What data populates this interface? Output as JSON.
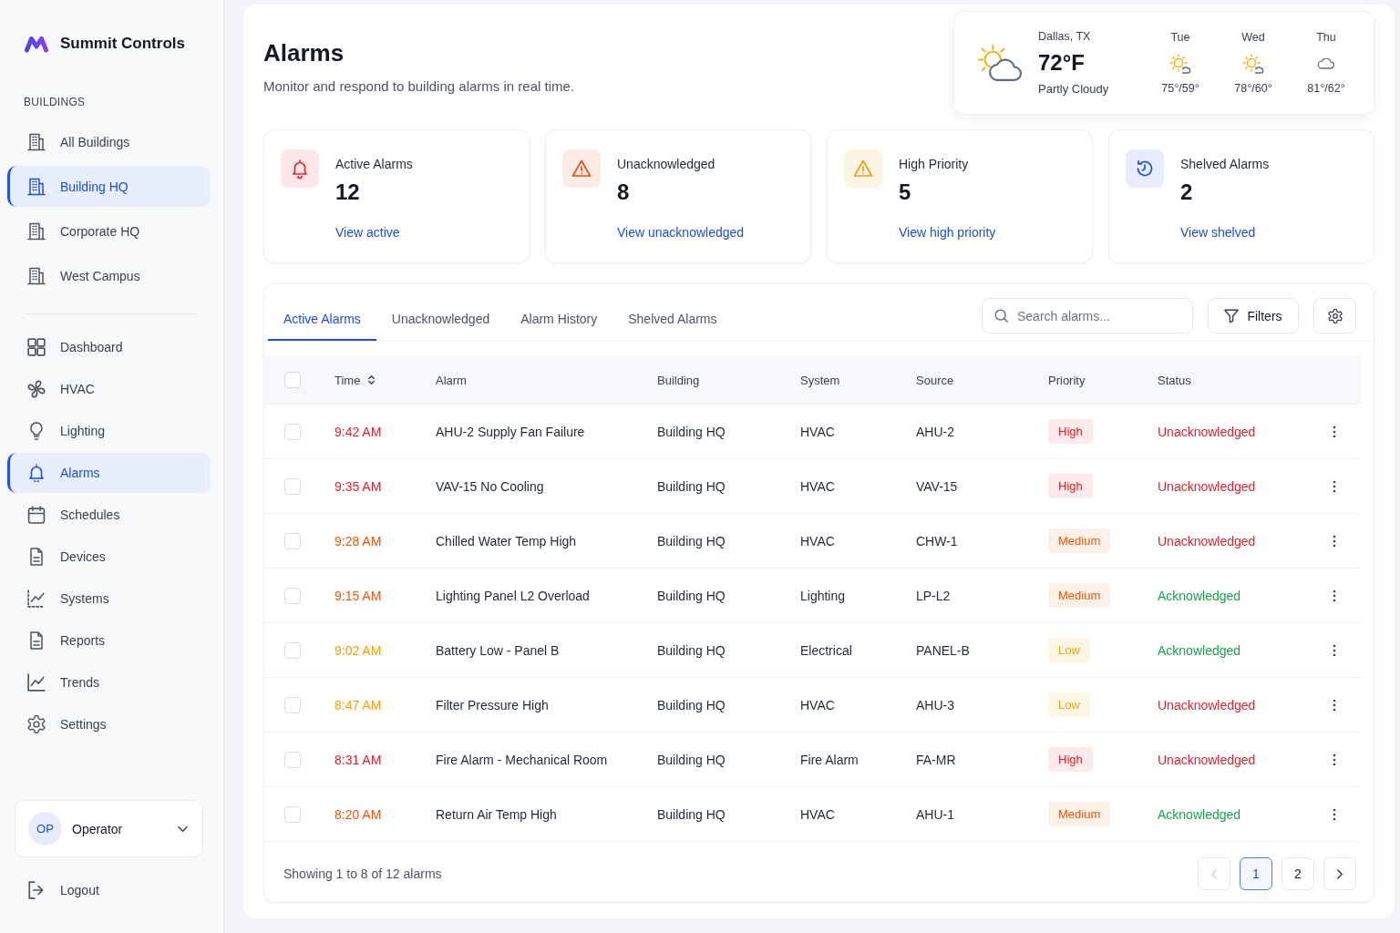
{
  "sidebar": {
    "brand": "Summit Controls",
    "section_label": "BUILDINGS",
    "buildings": [
      {
        "label": "All Buildings",
        "selected": false
      },
      {
        "label": "Building HQ",
        "selected": true
      },
      {
        "label": "Corporate HQ",
        "selected": false
      },
      {
        "label": "West Campus",
        "selected": false
      }
    ],
    "nav": [
      {
        "label": "Dashboard",
        "kind": "grid",
        "selected": false
      },
      {
        "label": "HVAC",
        "kind": "fan",
        "selected": false
      },
      {
        "label": "Lighting",
        "kind": "bulb",
        "selected": false
      },
      {
        "label": "Alarms",
        "kind": "bell",
        "selected": true
      },
      {
        "label": "Schedules",
        "kind": "calendar",
        "selected": false
      },
      {
        "label": "Devices",
        "kind": "document",
        "selected": false
      },
      {
        "label": "Systems",
        "kind": "dot-chart",
        "selected": false
      },
      {
        "label": "Reports",
        "kind": "document",
        "selected": false
      },
      {
        "label": "Trends",
        "kind": "chart",
        "selected": false
      },
      {
        "label": "Settings",
        "kind": "gear",
        "selected": false
      }
    ],
    "user": {
      "initials": "OP",
      "name": "Operator"
    },
    "logout": "Logout"
  },
  "header": {
    "title": "Alarms",
    "subtitle": "Monitor and respond to building alarms in real time."
  },
  "weather": {
    "location": "Dallas, TX",
    "temperature": "72°F",
    "condition": "Partly Cloudy",
    "forecast": [
      {
        "day": "Tue",
        "kind": "sun-cloud",
        "temps": "75°/59°"
      },
      {
        "day": "Wed",
        "kind": "sun-cloud",
        "temps": "78°/60°"
      },
      {
        "day": "Thu",
        "kind": "cloud",
        "temps": "81°/62°"
      }
    ]
  },
  "stats": [
    {
      "label": "Active Alarms",
      "value": "12",
      "link": "View active",
      "kind": "bell",
      "color": "#e5262c"
    },
    {
      "label": "Unacknowledged",
      "value": "8",
      "link": "View unacknowledged",
      "kind": "warning",
      "color": "#ea4f12"
    },
    {
      "label": "High Priority",
      "value": "5",
      "link": "View high priority",
      "kind": "warning",
      "color": "#f0a00c"
    },
    {
      "label": "Shelved Alarms",
      "value": "2",
      "link": "View shelved",
      "kind": "clock",
      "color": "#1d4ed8"
    }
  ],
  "tabs": [
    {
      "label": "Active Alarms",
      "selected": true
    },
    {
      "label": "Unacknowledged",
      "selected": false
    },
    {
      "label": "Alarm History",
      "selected": false
    },
    {
      "label": "Shelved Alarms",
      "selected": false
    }
  ],
  "search": {
    "placeholder": "Search alarms..."
  },
  "filters_button": "Filters",
  "table": {
    "select_all_checked": false,
    "columns": [
      {
        "label": "Time",
        "sortable": true
      },
      {
        "label": "Alarm",
        "sortable": false
      },
      {
        "label": "Building",
        "sortable": false
      },
      {
        "label": "System",
        "sortable": false
      },
      {
        "label": "Source",
        "sortable": false
      },
      {
        "label": "Priority",
        "sortable": false
      },
      {
        "label": "Status",
        "sortable": false
      }
    ],
    "rows": [
      {
        "checked": false,
        "kind": "high",
        "time": "9:42 AM",
        "alarm": "AHU-2 Supply Fan Failure",
        "building": "Building HQ",
        "system": "HVAC",
        "source": "AHU-2",
        "priority": "High",
        "status": "Unacknowledged",
        "acknowledged": false
      },
      {
        "checked": false,
        "kind": "high",
        "time": "9:35 AM",
        "alarm": "VAV-15 No Cooling",
        "building": "Building HQ",
        "system": "HVAC",
        "source": "VAV-15",
        "priority": "High",
        "status": "Unacknowledged",
        "acknowledged": false
      },
      {
        "checked": false,
        "kind": "medium",
        "time": "9:28 AM",
        "alarm": "Chilled Water Temp High",
        "building": "Building HQ",
        "system": "HVAC",
        "source": "CHW-1",
        "priority": "Medium",
        "status": "Unacknowledged",
        "acknowledged": false
      },
      {
        "checked": false,
        "kind": "medium",
        "time": "9:15 AM",
        "alarm": "Lighting Panel L2 Overload",
        "building": "Building HQ",
        "system": "Lighting",
        "source": "LP-L2",
        "priority": "Medium",
        "status": "Acknowledged",
        "acknowledged": true
      },
      {
        "checked": false,
        "kind": "low",
        "time": "9:02 AM",
        "alarm": "Battery Low - Panel B",
        "building": "Building HQ",
        "system": "Electrical",
        "source": "PANEL-B",
        "priority": "Low",
        "status": "Acknowledged",
        "acknowledged": true
      },
      {
        "checked": false,
        "kind": "low",
        "time": "8:47 AM",
        "alarm": "Filter Pressure High",
        "building": "Building HQ",
        "system": "HVAC",
        "source": "AHU-3",
        "priority": "Low",
        "status": "Unacknowledged",
        "acknowledged": false
      },
      {
        "checked": false,
        "kind": "high",
        "time": "8:31 AM",
        "alarm": "Fire Alarm - Mechanical Room",
        "building": "Building HQ",
        "system": "Fire Alarm",
        "source": "FA-MR",
        "priority": "High",
        "status": "Unacknowledged",
        "acknowledged": false
      },
      {
        "checked": false,
        "kind": "medium",
        "time": "8:20 AM",
        "alarm": "Return Air Temp High",
        "building": "Building HQ",
        "system": "HVAC",
        "source": "AHU-1",
        "priority": "Medium",
        "status": "Acknowledged",
        "acknowledged": true
      }
    ]
  },
  "footer": {
    "summary": "Showing 1 to 8 of 12 alarms",
    "prev_disabled": true,
    "next_disabled": false,
    "pages": [
      {
        "label": "1",
        "selected": true
      },
      {
        "label": "2",
        "selected": false
      }
    ]
  }
}
